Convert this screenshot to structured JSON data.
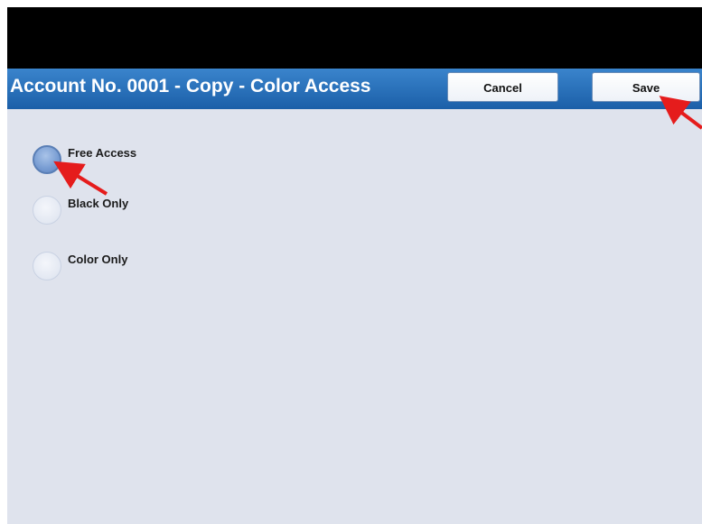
{
  "window": {
    "title": "Account No. 0001 - Copy - Color Access"
  },
  "header": {
    "cancel_label": "Cancel",
    "save_label": "Save"
  },
  "options": [
    {
      "label": "Free Access",
      "selected": true
    },
    {
      "label": "Black Only",
      "selected": false
    },
    {
      "label": "Color Only",
      "selected": false
    }
  ],
  "colors": {
    "title_bar": "#1b5fa8",
    "content_bg": "#dfe3ed",
    "annotation_arrow": "#e51c1c"
  }
}
